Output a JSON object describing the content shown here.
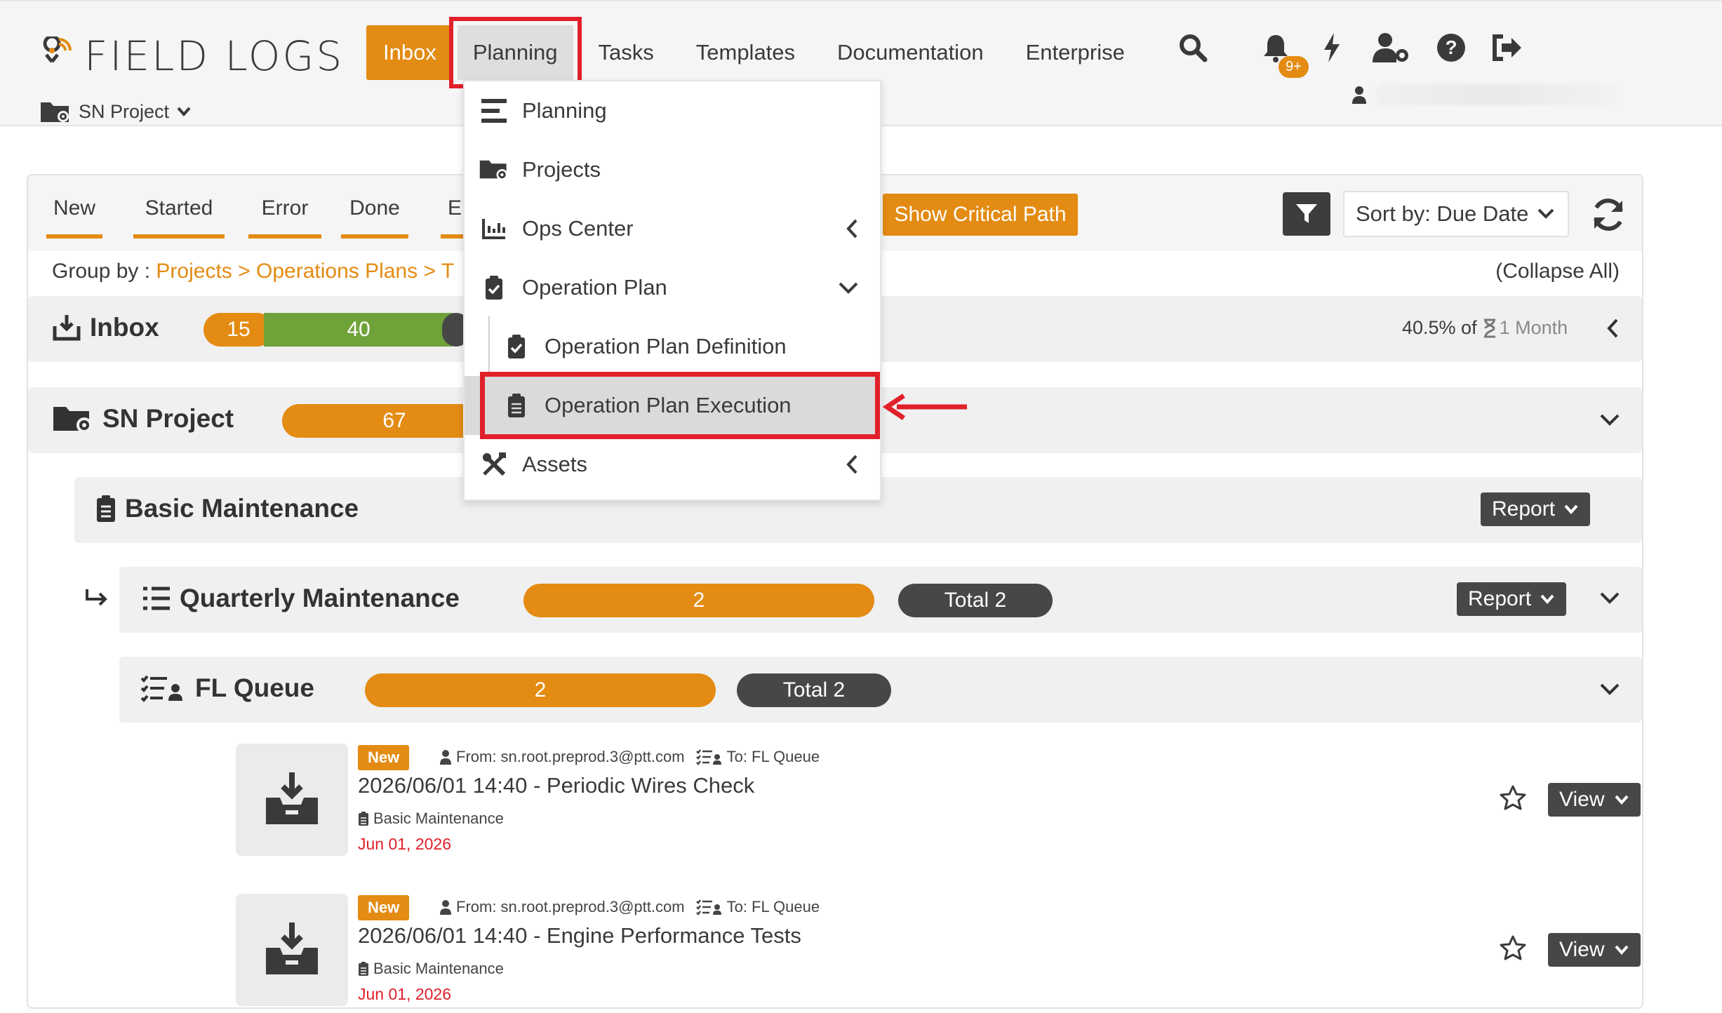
{
  "app": {
    "logo_text": "FIELD LOGS",
    "project_name": "SN Project"
  },
  "nav": {
    "inbox": "Inbox",
    "planning": "Planning",
    "tasks": "Tasks",
    "templates": "Templates",
    "documentation": "Documentation",
    "enterprise": "Enterprise"
  },
  "notifications": {
    "badge": "9+"
  },
  "planning_menu": {
    "items": [
      {
        "label": "Planning",
        "icon": "planning-icon"
      },
      {
        "label": "Projects",
        "icon": "project-folder-icon"
      },
      {
        "label": "Ops Center",
        "icon": "chart-icon"
      },
      {
        "label": "Operation Plan",
        "icon": "clipboard-check-icon"
      },
      {
        "label": "Operation Plan Definition",
        "icon": "clipboard-check-icon"
      },
      {
        "label": "Operation Plan Execution",
        "icon": "clipboard-list-icon"
      },
      {
        "label": "Assets",
        "icon": "tools-icon"
      }
    ]
  },
  "tabs": {
    "new": "New",
    "started": "Started",
    "error": "Error",
    "done": "Done",
    "partial": "E"
  },
  "toolbar": {
    "critical_path": "Show Critical Path",
    "sort": "Sort by: Due Date"
  },
  "groupby": {
    "label": "Group by :",
    "link1": "Projects",
    "sep1": ">",
    "link2": "Operations Plans",
    "sep2": ">",
    "link3": "T",
    "collapse_all": "(Collapse All)"
  },
  "inbox_row": {
    "title": "Inbox",
    "count_orange": "15",
    "count_green": "40",
    "progress": "40.5% of",
    "period": "1 Month"
  },
  "project_row": {
    "title": "SN Project",
    "count": "67"
  },
  "plan_row": {
    "title": "Basic Maintenance",
    "report": "Report"
  },
  "schedule_row": {
    "title": "Quarterly Maintenance",
    "count": "2",
    "total": "Total 2",
    "report": "Report"
  },
  "queue_row": {
    "title": "FL Queue",
    "count": "2",
    "total": "Total 2"
  },
  "tasks": [
    {
      "status": "New",
      "from": "From: sn.root.preprod.3@ptt.com",
      "to": "To: FL Queue",
      "title": "2026/06/01 14:40 - Periodic Wires Check",
      "plan": "Basic Maintenance",
      "date": "Jun 01, 2026",
      "view": "View"
    },
    {
      "status": "New",
      "from": "From: sn.root.preprod.3@ptt.com",
      "to": "To: FL Queue",
      "title": "2026/06/01 14:40 - Engine Performance Tests",
      "plan": "Basic Maintenance",
      "date": "Jun 01, 2026",
      "view": "View"
    }
  ],
  "colors": {
    "accent": "#e38b12",
    "dark": "#474747",
    "green": "#70a23a",
    "highlight": "#e1202a"
  }
}
